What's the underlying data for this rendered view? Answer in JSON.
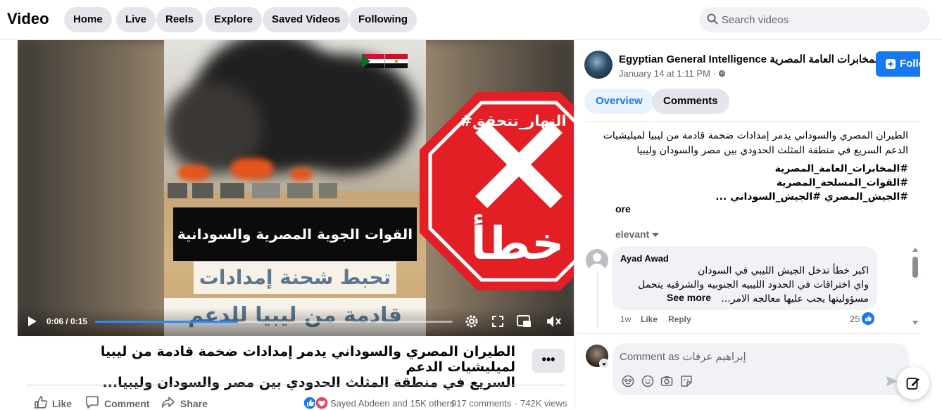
{
  "header": {
    "title": "Video",
    "nav": [
      "Home",
      "Live",
      "Reels",
      "Explore",
      "Saved Videos",
      "Following"
    ],
    "search_placeholder": "Search videos"
  },
  "video": {
    "caption_line1": "القوات الجوية المصرية والسودانية",
    "caption_line2": "تحبط شحنة إمدادات",
    "caption_line3": "قادمة من ليبيا للدعم السريع",
    "stamp_hashtag": "#النهار_تتحقق",
    "stamp_word": "خطأ",
    "time_current": "0:06",
    "time_total": "0:15",
    "progress": 0.4
  },
  "post": {
    "title": "الطيران المصري والسوداني يدمر إمدادات ضخمة قادمة من ليبيا لميليشيات الدعم السريع في منطقة المثلث الحدودي بين مصر والسودان وليبيا...",
    "title_line1": "الطيران المصري والسوداني يدمر إمدادات ضخمة قادمة من ليبيا لميليشيات الدعم",
    "title_line2": "السريع في منطقة المثلث الحدودي بين مصر والسودان وليبيا...",
    "more_label": "•••",
    "actions": {
      "like": "Like",
      "comment": "Comment",
      "share": "Share"
    },
    "reactions_text": "Sayed Abdeen and 15K others",
    "comments_count": "917 comments",
    "views": "742K views",
    "separator": "·"
  },
  "panel": {
    "page_name": "Egyptian General Intelligence المخابرات العامة المصرية",
    "date": "January 14 at 1:11 PM",
    "follow_label": "Follow",
    "tabs": [
      "Overview",
      "Comments"
    ],
    "description_lines": [
      "الطيران المصري والسوداني يدمر إمدادات ضخمة قادمة من ليبيا لميليشيات",
      "الدعم السريع في منطقة المثلث الحدودي بين مصر والسودان وليبيا"
    ],
    "hashtags": [
      "#المخابرات_العامة_المصرية",
      "#القوات_المسلحة_المصرية",
      "#الجيش_المصري #الجيش_السوداني ..."
    ],
    "see_more": "ore",
    "sort_label": "elevant",
    "comment": {
      "author": "Ayad Awad",
      "lines": [
        "اكبر خطأ تدخل الجيش الليبي في السودان",
        "واي اختراقات في الحدود الليبيه الجنوبيه والشرقيه يتحمل",
        "مسؤوليتها يجب عليها معالجه الامر..."
      ],
      "see_more": "See more",
      "age": "1w",
      "like": "Like",
      "reply": "Reply",
      "reactions": "25"
    },
    "comment_placeholder": "Comment as إبراهيم عرفات"
  },
  "colors": {
    "accent": "#1877f2",
    "stop_red": "#e31e24",
    "pill_bg": "#e4e6eb",
    "muted_text": "#65676b"
  }
}
